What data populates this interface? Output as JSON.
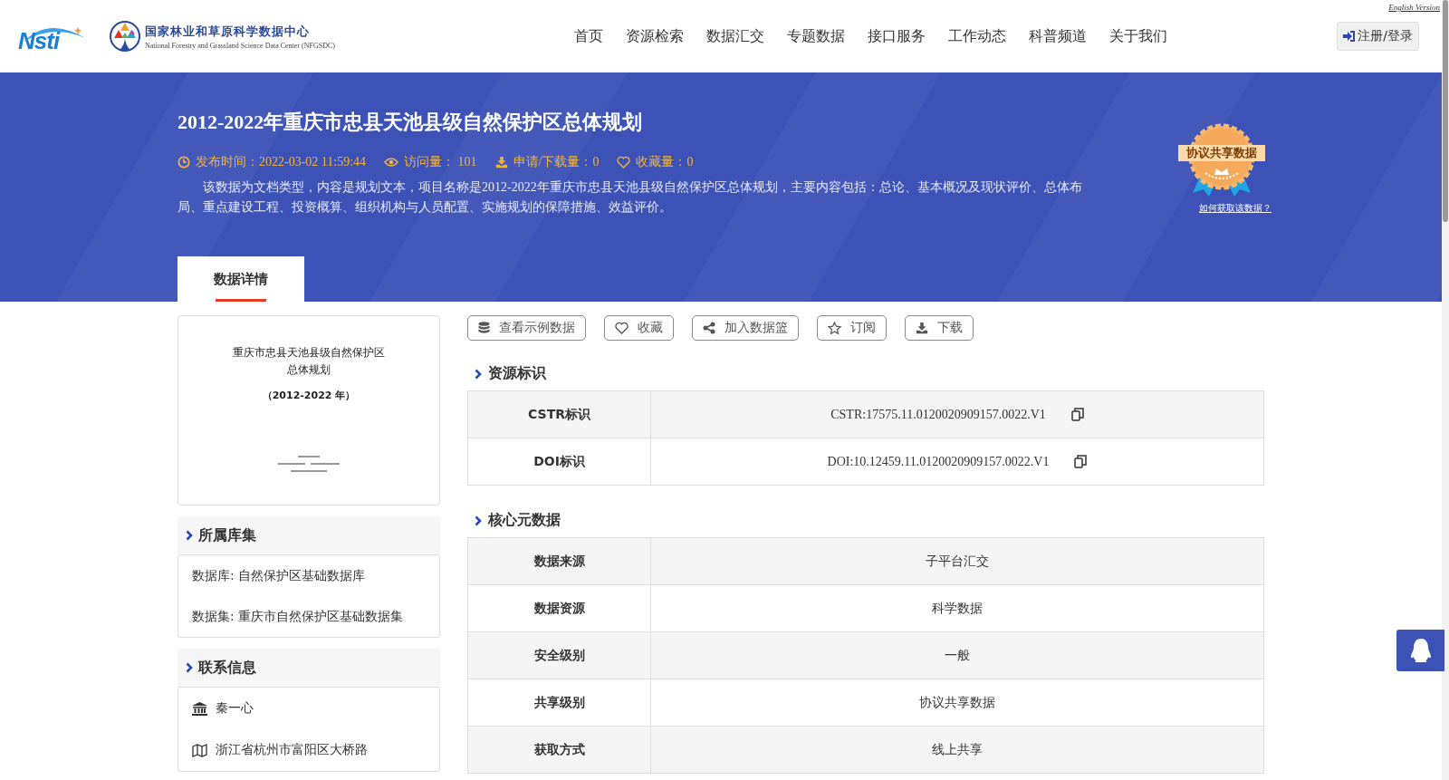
{
  "header": {
    "logo_text": "Nsti",
    "org_name": "国家林业和草原科学数据中心",
    "org_name_en": "National Forestry and Grassland Science Data Center (NFGSDC)",
    "english_link": "English Version",
    "nav": [
      {
        "label": "首页",
        "selected": false
      },
      {
        "label": "资源检索",
        "selected": false
      },
      {
        "label": "数据汇交",
        "selected": false
      },
      {
        "label": "专题数据",
        "selected": false
      },
      {
        "label": "接口服务",
        "selected": false
      },
      {
        "label": "工作动态",
        "selected": false
      },
      {
        "label": "科普频道",
        "selected": false
      },
      {
        "label": "关于我们",
        "selected": false
      }
    ],
    "login_button": "注册/登录"
  },
  "banner": {
    "title": "2012-2022年重庆市忠县天池县级自然保护区总体规划",
    "meta": [
      {
        "kind": "time",
        "text": "发布时间：2022-03-02 11:59:44"
      },
      {
        "kind": "views",
        "text": "访问量： 101"
      },
      {
        "kind": "downloads",
        "text": "申请/下载量：0"
      },
      {
        "kind": "favorites",
        "text": "收藏量：0"
      }
    ],
    "description": "该数据为文档类型，内容是规划文本，项目名称是2012-2022年重庆市忠县天池县级自然保护区总体规划，主要内容包括：总论、基本概况及现状评价、总体布局、重点建设工程、投资概算、组织机构与人员配置、实施规划的保障措施、效益评价。",
    "badge": {
      "label": "协议共享数据",
      "link": "如何获取该数据？"
    }
  },
  "tabs": [
    {
      "label": "数据详情",
      "selected": true
    }
  ],
  "thumbnail": {
    "lines": [
      "重庆市忠县天池县级自然保护区",
      "总体规划",
      "（2012-2022 年）"
    ]
  },
  "sidebar": [
    {
      "title": "所属库集",
      "items": [
        {
          "kind": "plain",
          "text": "数据库: 自然保护区基础数据库"
        },
        {
          "kind": "plain",
          "text": "数据集: 重庆市自然保护区基础数据集"
        }
      ]
    },
    {
      "title": "联系信息",
      "items": [
        {
          "kind": "person",
          "text": "秦一心"
        },
        {
          "kind": "address",
          "text": "浙江省杭州市富阳区大桥路"
        }
      ]
    }
  ],
  "actions": [
    {
      "kind": "sample",
      "label": "查看示例数据"
    },
    {
      "kind": "favorite",
      "label": "收藏"
    },
    {
      "kind": "basket",
      "label": "加入数据篮"
    },
    {
      "kind": "subscribe",
      "label": "订阅"
    },
    {
      "kind": "download",
      "label": "下载"
    }
  ],
  "sections": [
    {
      "title": "资源标识",
      "rows": [
        {
          "label": "CSTR标识",
          "value": "CSTR:17575.11.0120020909157.0022.V1",
          "copyable": true
        },
        {
          "label": "DOI标识",
          "value": "DOI:10.12459.11.0120020909157.0022.V1",
          "copyable": true
        }
      ]
    },
    {
      "title": "核心元数据",
      "rows": [
        {
          "label": "数据来源",
          "value": "子平台汇交",
          "copyable": false
        },
        {
          "label": "数据资源",
          "value": "科学数据",
          "copyable": false
        },
        {
          "label": "安全级别",
          "value": "一般",
          "copyable": false
        },
        {
          "label": "共享级别",
          "value": "协议共享数据",
          "copyable": false
        },
        {
          "label": "获取方式",
          "value": "线上共享",
          "copyable": false
        }
      ]
    }
  ]
}
